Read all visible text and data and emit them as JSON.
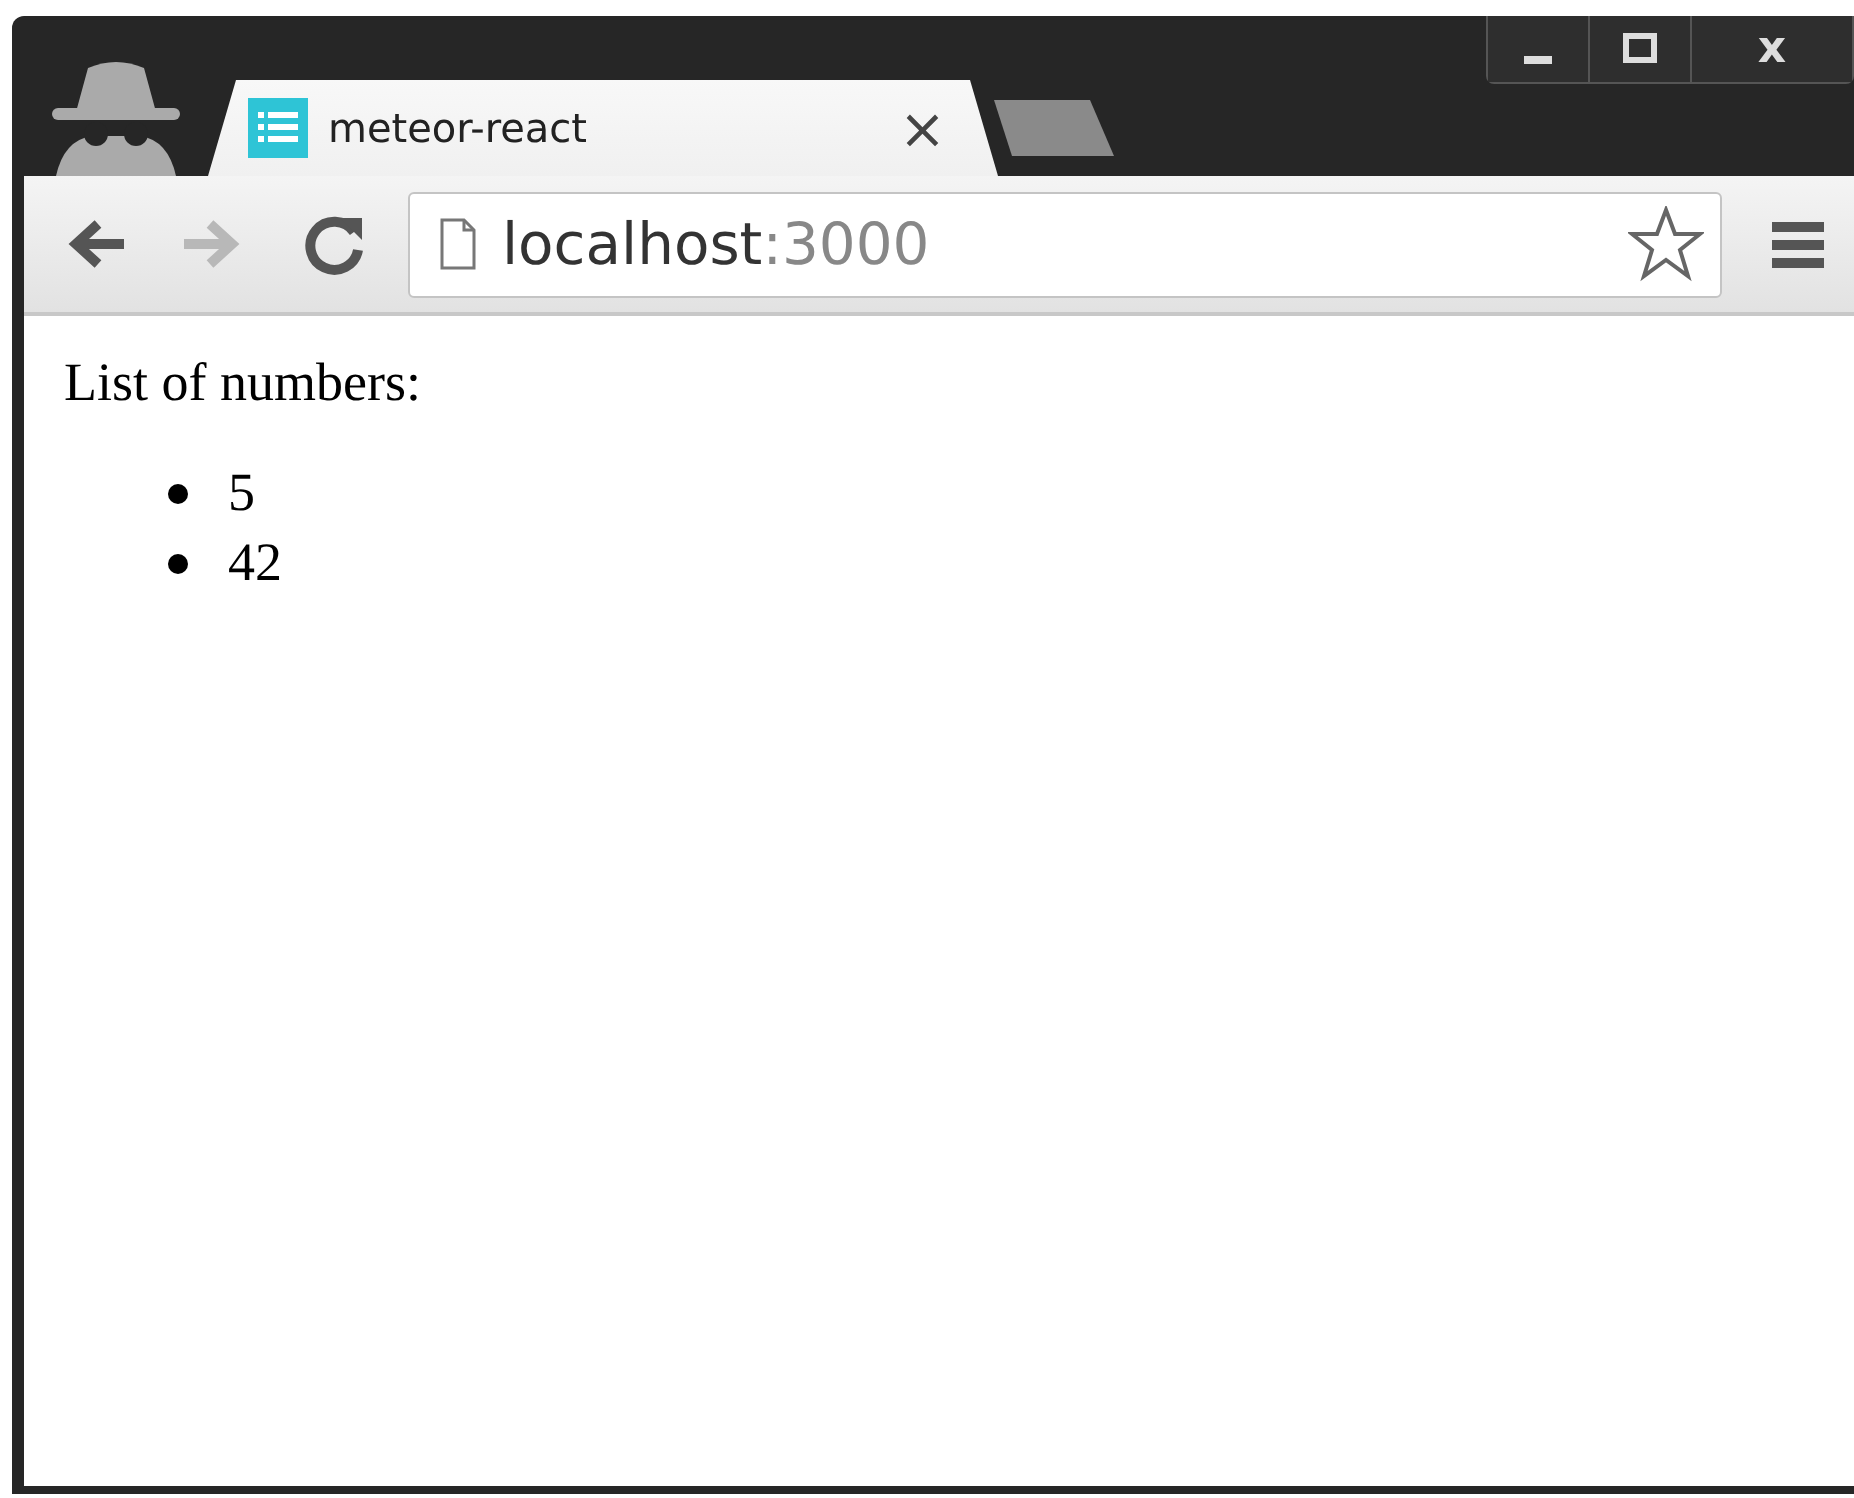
{
  "window": {
    "buttons": [
      "x"
    ]
  },
  "tabs": [
    {
      "title": "meteor-react",
      "close": "×",
      "selected": true
    }
  ],
  "address_bar": {
    "host": "localhost",
    "port": ":3000"
  },
  "page": {
    "heading": "List of numbers:",
    "items": [
      "5",
      "42"
    ]
  }
}
